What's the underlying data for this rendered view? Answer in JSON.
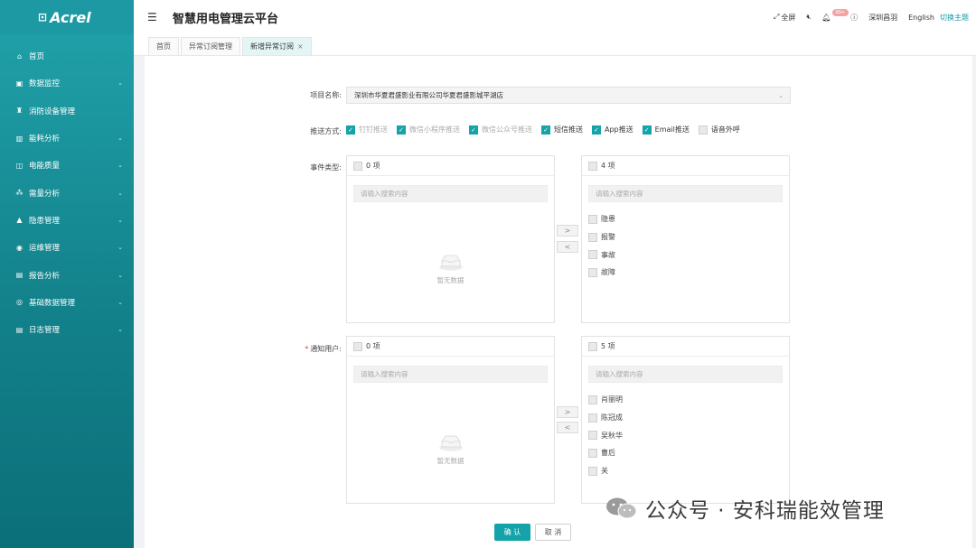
{
  "sidebar": {
    "logo_text": "Acrel",
    "items": [
      {
        "icon": "home-icon",
        "label": "首页",
        "chevron": false
      },
      {
        "icon": "monitor-icon",
        "label": "数据监控",
        "chevron": true
      },
      {
        "icon": "fire-device-icon",
        "label": "消防设备管理",
        "chevron": false
      },
      {
        "icon": "energy-icon",
        "label": "能耗分析",
        "chevron": true
      },
      {
        "icon": "power-quality-icon",
        "label": "电能质量",
        "chevron": true
      },
      {
        "icon": "demand-icon",
        "label": "需量分析",
        "chevron": true
      },
      {
        "icon": "hazard-icon",
        "label": "隐患管理",
        "chevron": true
      },
      {
        "icon": "ops-icon",
        "label": "运维管理",
        "chevron": true
      },
      {
        "icon": "report-icon",
        "label": "报告分析",
        "chevron": true
      },
      {
        "icon": "base-data-icon",
        "label": "基础数据管理",
        "chevron": true
      },
      {
        "icon": "log-icon",
        "label": "日志管理",
        "chevron": true
      }
    ]
  },
  "header": {
    "title": "智慧用电管理云平台",
    "fullscreen": "全屏",
    "mute_icon": "mute-icon",
    "bell_badge": "99+",
    "help_icon": "help-icon",
    "user": "深圳昌羽",
    "language": "English",
    "theme": "切换主题"
  },
  "tabs": [
    {
      "label": "首页",
      "active": false,
      "closable": false
    },
    {
      "label": "异常订阅管理",
      "active": false,
      "closable": false
    },
    {
      "label": "新增异常订阅",
      "active": true,
      "closable": true
    }
  ],
  "form": {
    "project_label": "项目名称:",
    "project_value": "深圳市华夏君盛影业有限公司华夏君盛影城平湖店",
    "push_label": "推送方式:",
    "push_options": [
      {
        "label": "钉钉推送",
        "checked": true,
        "disabled": true
      },
      {
        "label": "微信小程序推送",
        "checked": true,
        "disabled": true
      },
      {
        "label": "微信公众号推送",
        "checked": true,
        "disabled": true
      },
      {
        "label": "短信推送",
        "checked": true,
        "disabled": false
      },
      {
        "label": "App推送",
        "checked": true,
        "disabled": false
      },
      {
        "label": "Email推送",
        "checked": true,
        "disabled": false
      },
      {
        "label": "语音外呼",
        "checked": false,
        "disabled": false
      }
    ],
    "event_label": "事件类型:",
    "event_left": {
      "count": "0 项",
      "placeholder": "请输入搜索内容",
      "empty": "暂无数据"
    },
    "event_right": {
      "count": "4 项",
      "placeholder": "请输入搜索内容",
      "items": [
        "隐患",
        "报警",
        "事故",
        "故障"
      ]
    },
    "user_label": "通知用户:",
    "user_left": {
      "count": "0 项",
      "placeholder": "请输入搜索内容",
      "empty": "暂无数据"
    },
    "user_right": {
      "count": "5 项",
      "placeholder": "请输入搜索内容",
      "items": [
        "肖丽明",
        "陈冠成",
        "吴秋华",
        "曹后",
        "关"
      ]
    },
    "move_right": ">",
    "move_left": "<",
    "confirm": "确 认",
    "cancel": "取 消"
  },
  "watermark": "公众号 · 安科瑞能效管理"
}
